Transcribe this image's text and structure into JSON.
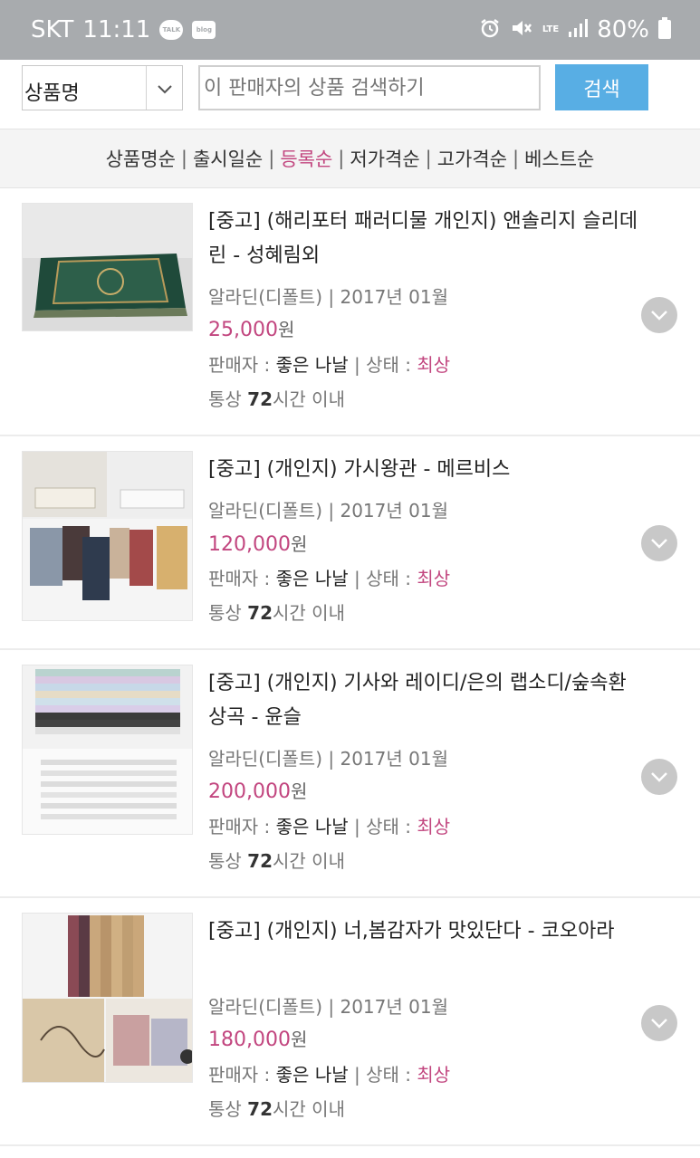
{
  "status_bar": {
    "carrier": "SKT",
    "time": "11:11",
    "notif_talk": "TALK",
    "notif_blog": "blog",
    "network": "LTE",
    "battery": "80%"
  },
  "search": {
    "category": "상품명",
    "placeholder": "이 판매자의 상품 검색하기",
    "button": "검색"
  },
  "sort": {
    "options": [
      "상품명순",
      "출시일순",
      "등록순",
      "저가격순",
      "고가격순",
      "베스트순"
    ],
    "active": "등록순"
  },
  "items": [
    {
      "title": "[중고] (해리포터 패러디물 개인지) 앤솔리지 슬리데린 - 성혜림외",
      "publisher": "알라딘(디폴트)",
      "date": "2017년 01월",
      "price": "25,000",
      "currency": "원",
      "seller_label": "판매자 :",
      "seller": "좋은 나날",
      "condition_label": "상태 :",
      "condition": "최상",
      "ship_prefix": "통상",
      "ship_hours": "72",
      "ship_suffix": "시간 이내"
    },
    {
      "title": "[중고] (개인지) 가시왕관 - 메르비스",
      "publisher": "알라딘(디폴트)",
      "date": "2017년 01월",
      "price": "120,000",
      "currency": "원",
      "seller_label": "판매자 :",
      "seller": "좋은 나날",
      "condition_label": "상태 :",
      "condition": "최상",
      "ship_prefix": "통상",
      "ship_hours": "72",
      "ship_suffix": "시간 이내"
    },
    {
      "title": "[중고] (개인지) 기사와 레이디/은의 랩소디/숲속환상곡 - 윤슬",
      "publisher": "알라딘(디폴트)",
      "date": "2017년 01월",
      "price": "200,000",
      "currency": "원",
      "seller_label": "판매자 :",
      "seller": "좋은 나날",
      "condition_label": "상태 :",
      "condition": "최상",
      "ship_prefix": "통상",
      "ship_hours": "72",
      "ship_suffix": "시간 이내"
    },
    {
      "title": "[중고] (개인지) 너,봄감자가 맛있단다 - 코오아라",
      "publisher": "알라딘(디폴트)",
      "date": "2017년 01월",
      "price": "180,000",
      "currency": "원",
      "seller_label": "판매자 :",
      "seller": "좋은 나날",
      "condition_label": "상태 :",
      "condition": "최상",
      "ship_prefix": "통상",
      "ship_hours": "72",
      "ship_suffix": "시간 이내"
    }
  ],
  "colors": {
    "accent_pink": "#c2467f",
    "search_button": "#58aee4",
    "status_bar": "#a8abae"
  },
  "icons": [
    "alarm-icon",
    "mute-icon",
    "signal-icon",
    "battery-icon",
    "chevron-down-icon",
    "expand-icon"
  ]
}
